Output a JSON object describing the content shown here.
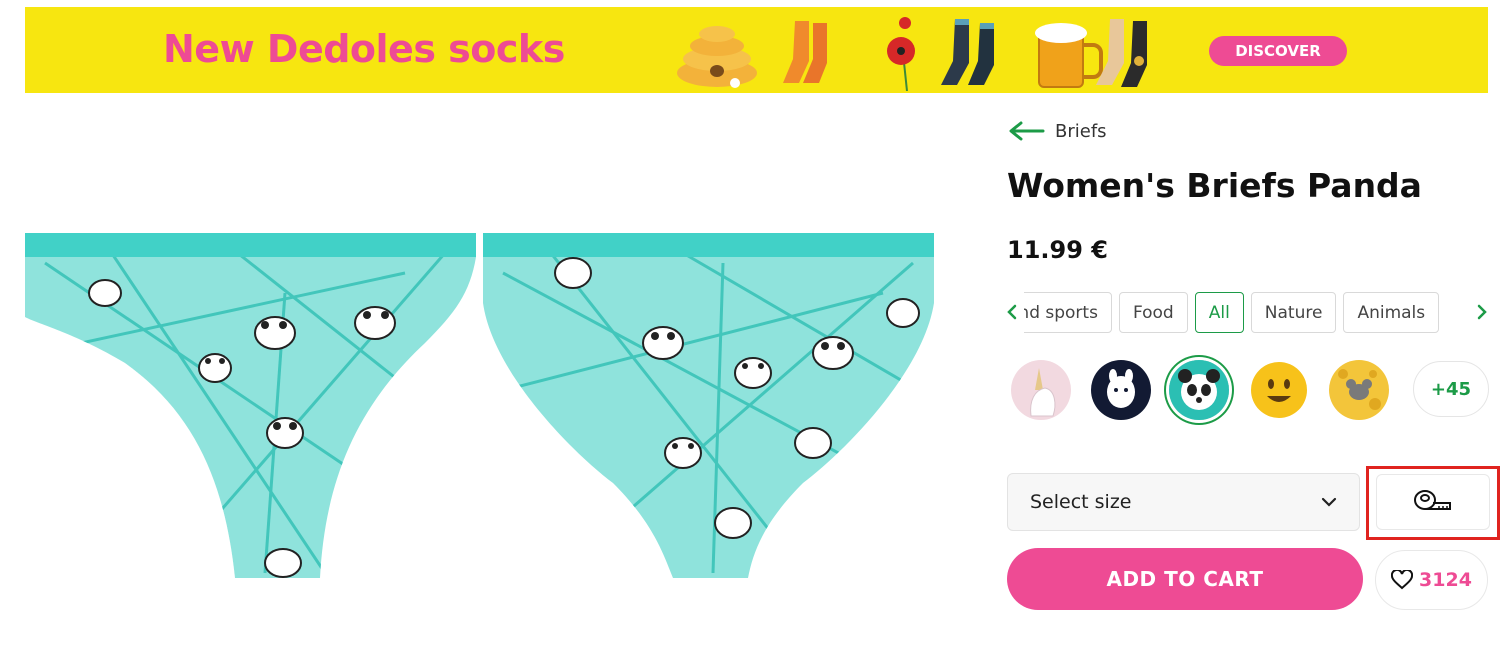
{
  "banner": {
    "headline": "New Dedoles socks",
    "cta_label": "DISCOVER",
    "colors": {
      "background": "#f7e610",
      "accent": "#ee4b94"
    }
  },
  "product": {
    "breadcrumb": "Briefs",
    "title": "Women's Briefs Panda",
    "price": "11.99 €"
  },
  "categories": {
    "items": [
      "and sports",
      "Food",
      "All",
      "Nature",
      "Animals"
    ],
    "active_index": 2
  },
  "designs": {
    "items": [
      "unicorn",
      "llama",
      "panda",
      "smiley",
      "cheese-mouse"
    ],
    "selected_index": 2,
    "more_label": "+45"
  },
  "size": {
    "placeholder": "Select size"
  },
  "actions": {
    "add_to_cart": "ADD TO CART",
    "favorites_count": "3124"
  },
  "icons": {
    "back": "arrow-left-icon",
    "prev": "chevron-left-icon",
    "next": "chevron-right-icon",
    "dropdown": "chevron-down-icon",
    "measure": "tape-measure-icon",
    "favorite": "heart-icon"
  },
  "theme": {
    "green": "#1c9b47",
    "pink": "#ee4b94",
    "highlight": "#e0231f"
  }
}
